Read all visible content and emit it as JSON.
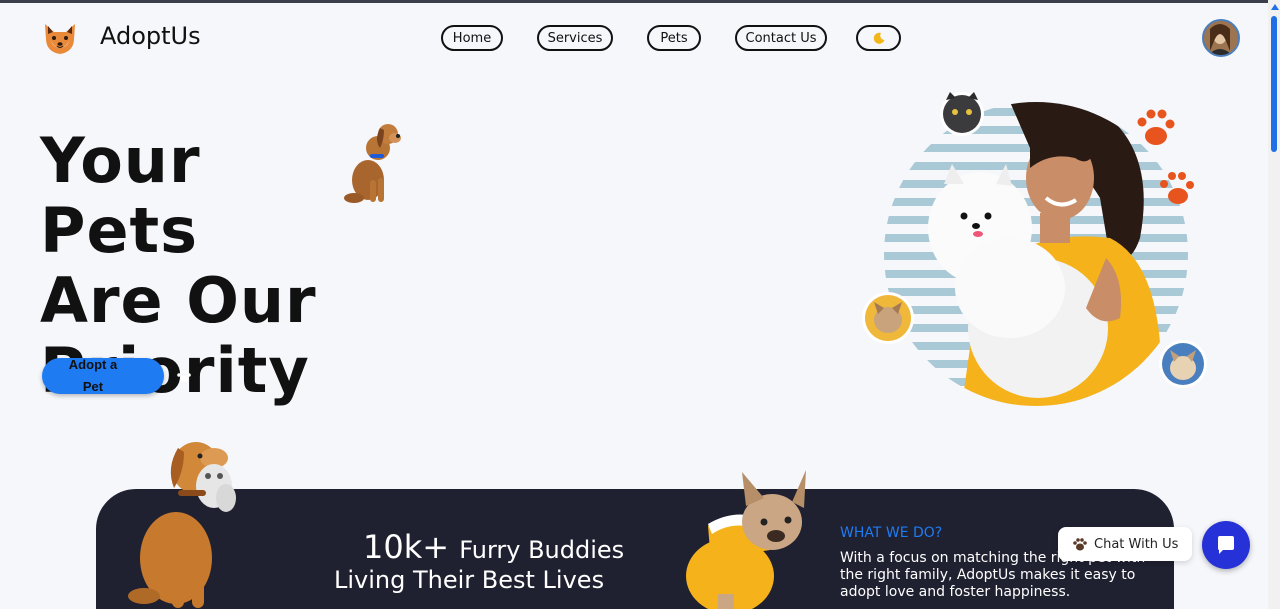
{
  "header": {
    "brand": "AdoptUs",
    "nav": [
      {
        "label": "Home"
      },
      {
        "label": "Services"
      },
      {
        "label": "Pets"
      },
      {
        "label": "Contact Us"
      }
    ],
    "theme_toggle_icon": "moon-icon",
    "avatar_icon": "user-avatar"
  },
  "hero": {
    "title_line1": "Your Pets",
    "title_line2": "Are Our",
    "title_line3": "Priority",
    "cta_line1": "Adopt a",
    "cta_line2": "Pet",
    "cta_icon": "paw-icon"
  },
  "about": {
    "stat": "10k+",
    "stat_text": "Furry Buddies",
    "stat_line2": "Living Their Best Lives",
    "heading": "WHAT WE DO?",
    "body": "With a focus on matching the right pet with the right family, AdoptUs makes it easy to adopt love and foster happiness."
  },
  "chat": {
    "label": "Chat With Us",
    "icon": "paw-icon",
    "fab_icon": "chat-bubble-icon"
  },
  "colors": {
    "accent": "#1e7bf2",
    "dark": "#1f2030",
    "chat_button": "#2632d8",
    "paw_orange": "#e8541e",
    "shirt_yellow": "#f5b21b"
  }
}
